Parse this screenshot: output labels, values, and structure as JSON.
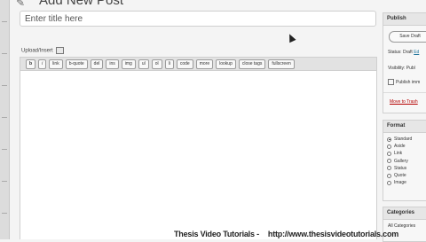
{
  "header": {
    "title": "Add New Post"
  },
  "title_input": {
    "placeholder": "Enter title here"
  },
  "upload": {
    "label": "Upload/Insert"
  },
  "toolbar": {
    "buttons": [
      "b",
      "i",
      "link",
      "b-quote",
      "del",
      "ins",
      "img",
      "ul",
      "ol",
      "li",
      "code",
      "more",
      "lookup",
      "close tags",
      "fullscreen"
    ]
  },
  "publish": {
    "heading": "Publish",
    "save_draft": "Save Draft",
    "status": "Status: Draft",
    "status_edit": "Ed",
    "visibility": "Visibility: Publ",
    "publish_time": "Publish imm",
    "trash": "Move to Trash"
  },
  "format": {
    "heading": "Format",
    "options": [
      "Standard",
      "Aside",
      "Link",
      "Gallery",
      "Status",
      "Quote",
      "Image"
    ],
    "selected": "Standard"
  },
  "categories": {
    "heading": "Categories",
    "tab_all": "All Categories"
  },
  "watermark": {
    "left": "Thesis Video Tutorials -",
    "right": "http://www.thesisvideotutorials.com"
  }
}
